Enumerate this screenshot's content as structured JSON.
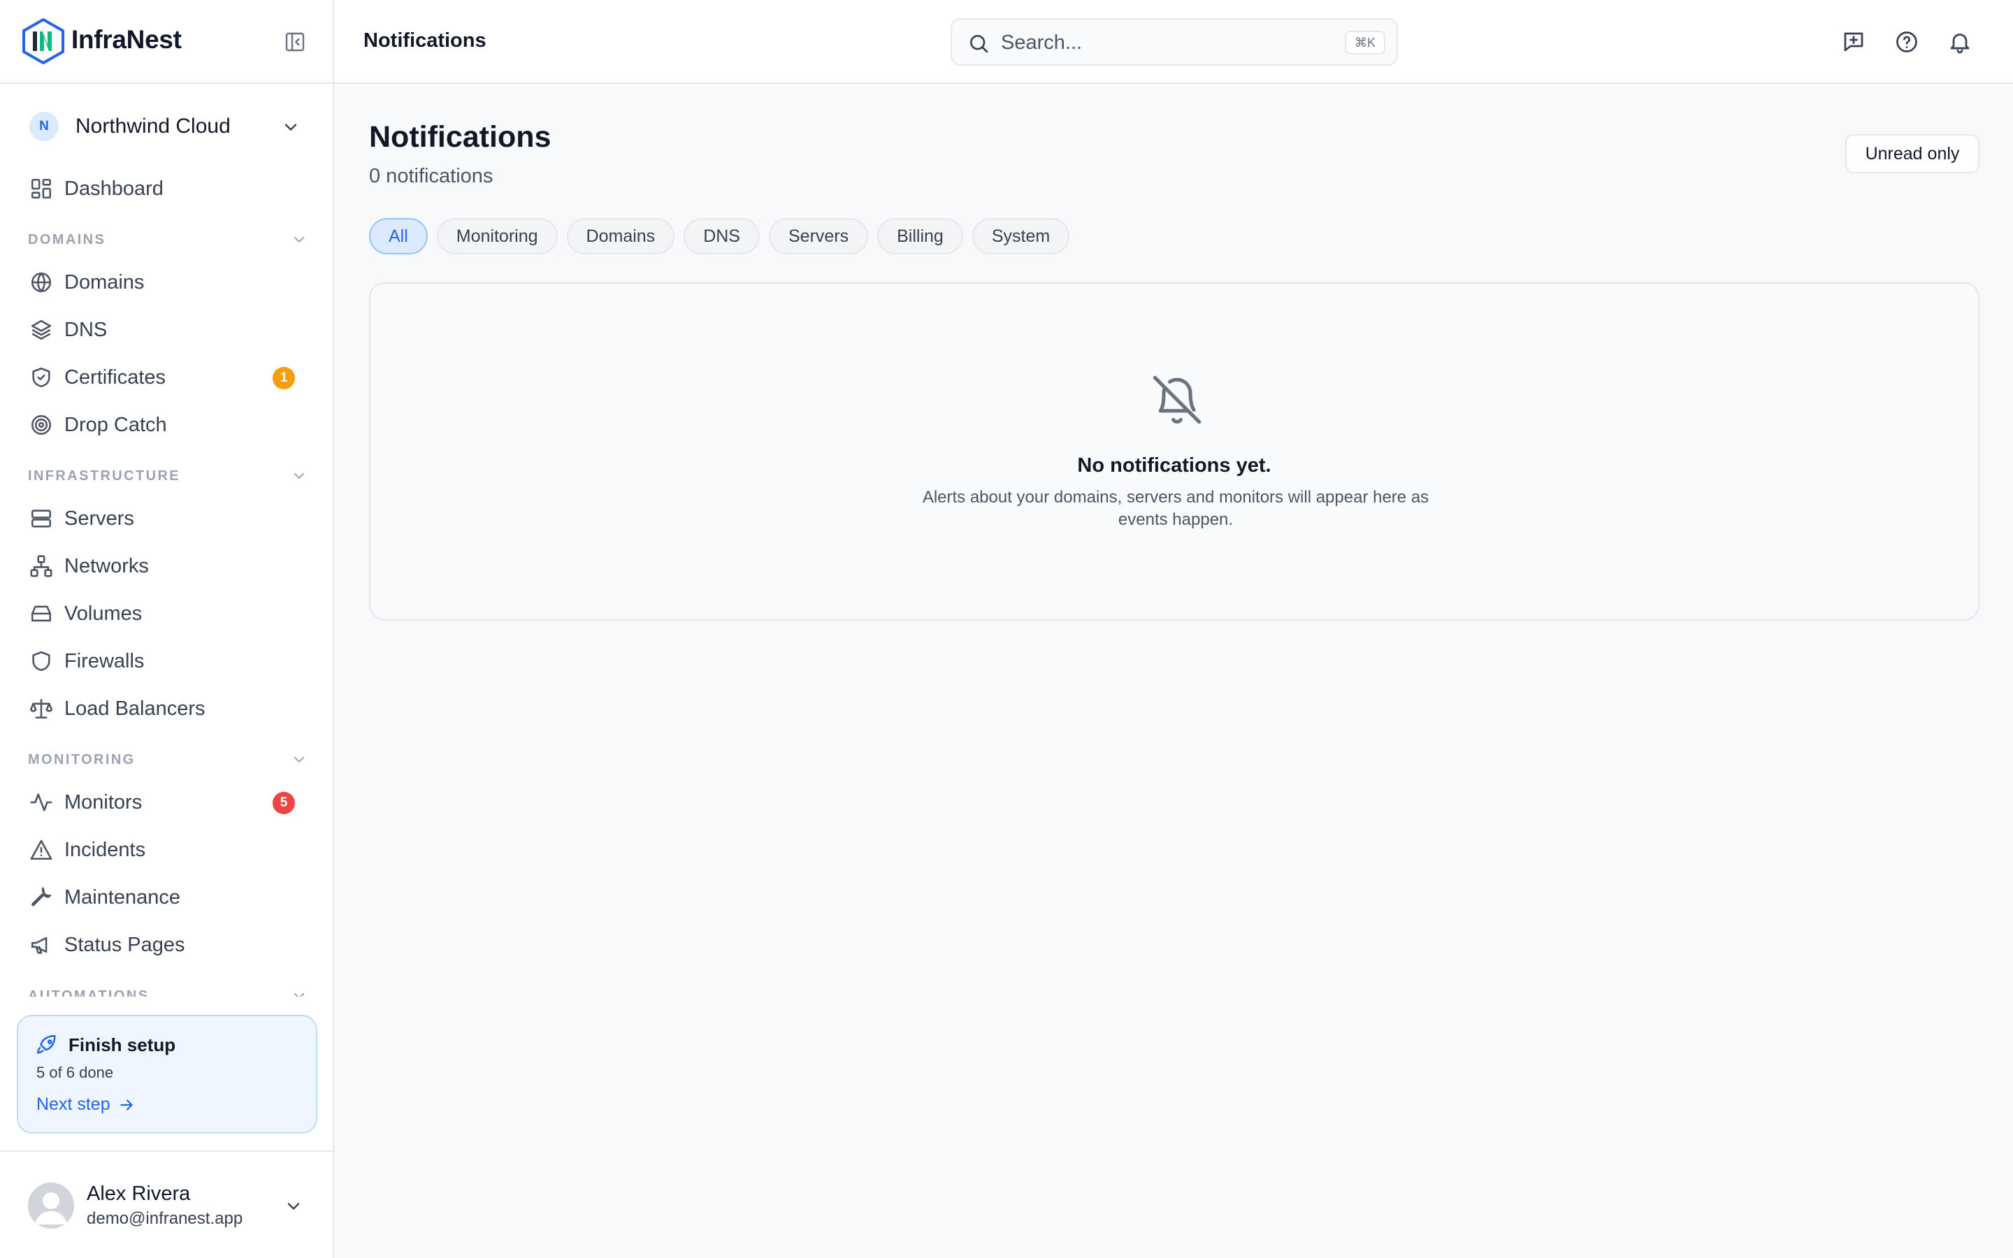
{
  "brand": {
    "name": "InfraNest"
  },
  "workspace": {
    "initial": "N",
    "name": "Northwind Cloud"
  },
  "nav": {
    "dashboard": "Dashboard",
    "sections": {
      "domains": "DOMAINS",
      "infrastructure": "INFRASTRUCTURE",
      "monitoring": "MONITORING",
      "automations": "AUTOMATIONS"
    },
    "domains": "Domains",
    "dns": "DNS",
    "certificates": "Certificates",
    "certificates_badge": "1",
    "drop_catch": "Drop Catch",
    "servers": "Servers",
    "networks": "Networks",
    "volumes": "Volumes",
    "firewalls": "Firewalls",
    "load_balancers": "Load Balancers",
    "monitors": "Monitors",
    "monitors_badge": "5",
    "incidents": "Incidents",
    "maintenance": "Maintenance",
    "status_pages": "Status Pages"
  },
  "setup": {
    "title": "Finish setup",
    "progress": "5 of 6 done",
    "progress_fraction": 0.833,
    "next": "Next step"
  },
  "user": {
    "name": "Alex Rivera",
    "email": "demo@infranest.app"
  },
  "topbar": {
    "title": "Notifications",
    "search_placeholder": "Search...",
    "search_shortcut": "⌘K"
  },
  "main": {
    "title": "Notifications",
    "count": "0 notifications",
    "unread_only": "Unread only",
    "filters": [
      "All",
      "Monitoring",
      "Domains",
      "DNS",
      "Servers",
      "Billing",
      "System"
    ],
    "active_filter": "All",
    "empty_title": "No notifications yet.",
    "empty_desc": "Alerts about your domains, servers and monitors will appear here as events happen."
  },
  "colors": {
    "accent": "#2563eb",
    "badge_warning": "#f59e0b",
    "badge_danger": "#ef4444"
  },
  "icons": {
    "brand": "infranest-logo",
    "collapse": "sidebar-collapse-icon",
    "empty_state": "bell-off-icon"
  }
}
